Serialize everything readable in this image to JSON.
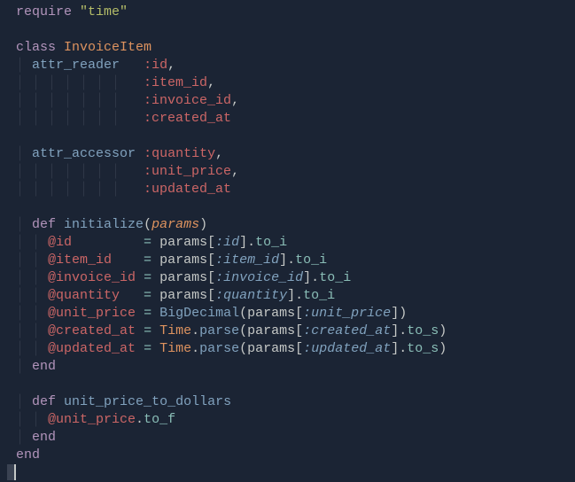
{
  "code": {
    "l1": {
      "require": "require",
      "time": "\"time\""
    },
    "l3": {
      "class": "class",
      "name": "InvoiceItem"
    },
    "l4": {
      "attr": "attr_reader",
      "sym": ":id",
      "comma": ","
    },
    "l5": {
      "sym": ":item_id",
      "comma": ","
    },
    "l6": {
      "sym": ":invoice_id",
      "comma": ","
    },
    "l7": {
      "sym": ":created_at"
    },
    "l9": {
      "attr": "attr_accessor",
      "sym": ":quantity",
      "comma": ","
    },
    "l10": {
      "sym": ":unit_price",
      "comma": ","
    },
    "l11": {
      "sym": ":updated_at"
    },
    "l13": {
      "def": "def",
      "name": "initialize",
      "lp": "(",
      "param": "params",
      "rp": ")"
    },
    "l14": {
      "ivar": "@id",
      "eq": "=",
      "params": "params",
      "lb": "[",
      "sym": ":id",
      "rb": "]",
      "dot": ".",
      "method": "to_i"
    },
    "l15": {
      "ivar": "@item_id",
      "eq": "=",
      "params": "params",
      "lb": "[",
      "sym": ":item_id",
      "rb": "]",
      "dot": ".",
      "method": "to_i"
    },
    "l16": {
      "ivar": "@invoice_id",
      "eq": "=",
      "params": "params",
      "lb": "[",
      "sym": ":invoice_id",
      "rb": "]",
      "dot": ".",
      "method": "to_i"
    },
    "l17": {
      "ivar": "@quantity",
      "eq": "=",
      "params": "params",
      "lb": "[",
      "sym": ":quantity",
      "rb": "]",
      "dot": ".",
      "method": "to_i"
    },
    "l18": {
      "ivar": "@unit_price",
      "eq": "=",
      "call": "BigDecimal",
      "lp": "(",
      "params": "params",
      "lb": "[",
      "sym": ":unit_price",
      "rb": "]",
      "rp": ")",
      "rp2": ")"
    },
    "l19": {
      "ivar": "@created_at",
      "eq": "=",
      "type": "Time",
      "dot": ".",
      "parse": "parse",
      "lp": "(",
      "params": "params",
      "lb": "[",
      "sym": ":created_at",
      "rb": "]",
      "dot2": ".",
      "tos": "to_s",
      "rp": ")"
    },
    "l20": {
      "ivar": "@updated_at",
      "eq": "=",
      "type": "Time",
      "dot": ".",
      "parse": "parse",
      "lp": "(",
      "params": "params",
      "lb": "[",
      "sym": ":updated_at",
      "rb": "]",
      "dot2": ".",
      "tos": "to_s",
      "rp": ")"
    },
    "l21": {
      "end": "end"
    },
    "l23": {
      "def": "def",
      "name": "unit_price_to_dollars"
    },
    "l24": {
      "ivar": "@unit_price",
      "dot": ".",
      "method": "to_f"
    },
    "l25": {
      "end": "end"
    },
    "l26": {
      "end": "end"
    }
  },
  "guides": {
    "g1": "│ ",
    "g2": "│ │ ",
    "g7": "│ │ │ │ │ │ │ "
  }
}
